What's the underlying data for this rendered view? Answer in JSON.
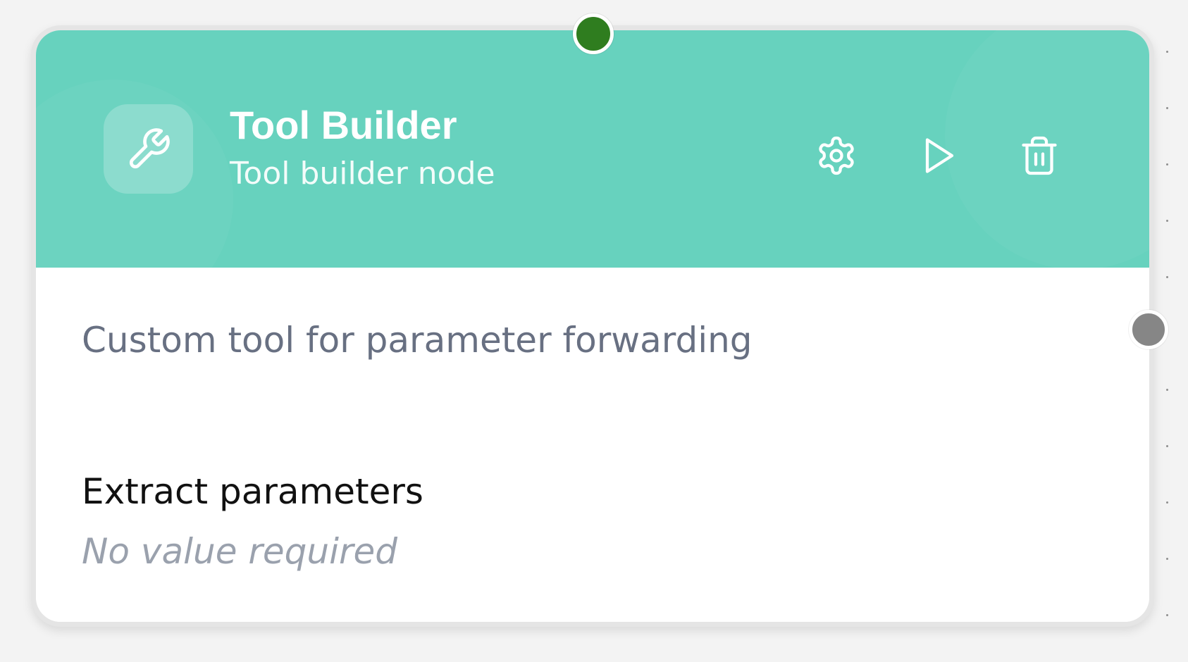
{
  "node": {
    "title": "Tool Builder",
    "subtitle": "Tool builder node",
    "icon": "wrench-icon",
    "header_color": "#67d2be",
    "actions": [
      {
        "name": "settings",
        "icon": "gear-icon"
      },
      {
        "name": "run",
        "icon": "play-icon"
      },
      {
        "name": "delete",
        "icon": "trash-icon"
      }
    ],
    "description": "Custom tool for parameter forwarding",
    "params": [
      {
        "label": "Extract parameters",
        "value": "No value required"
      }
    ]
  },
  "handles": {
    "input_color": "#2f7d1f",
    "output_color": "#868686"
  }
}
